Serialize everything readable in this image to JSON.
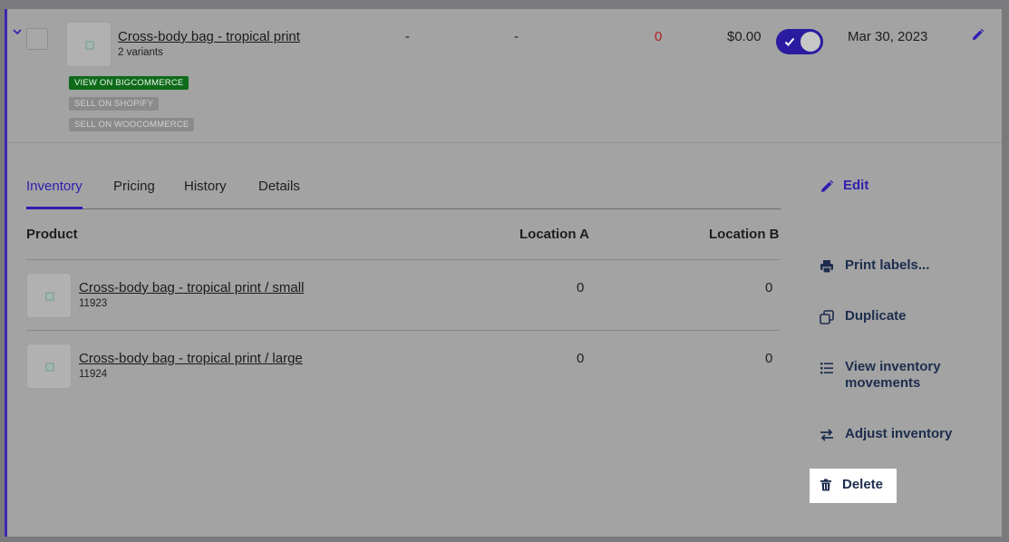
{
  "product": {
    "title": "Cross-body bag - tropical print",
    "variants_text": "2 variants",
    "badges": [
      "VIEW ON BIGCOMMERCE",
      "SELL ON SHOPIFY",
      "SELL ON WOOCOMMERCE"
    ],
    "col1": "-",
    "col2": "-",
    "stock": "0",
    "price": "$0.00",
    "active": true,
    "date": "Mar 30, 2023"
  },
  "colors": {
    "accent": "#2f1eb0",
    "stock_zero": "#b22222",
    "badge_green": "#0f6b1a"
  },
  "tabs": [
    "Inventory",
    "Pricing",
    "History",
    "Details"
  ],
  "active_tab": "Inventory",
  "table": {
    "headers": [
      "Product",
      "Location A",
      "Location B"
    ],
    "rows": [
      {
        "name": "Cross-body bag - tropical print / small",
        "sku": "11923",
        "loc_a": "0",
        "loc_b": "0"
      },
      {
        "name": "Cross-body bag - tropical print / large",
        "sku": "11924",
        "loc_a": "0",
        "loc_b": "0"
      }
    ]
  },
  "actions": {
    "edit": "Edit",
    "print_labels": "Print labels...",
    "duplicate": "Duplicate",
    "view_movements_line1": "View inventory",
    "view_movements_line2": "movements",
    "adjust": "Adjust inventory",
    "delete": "Delete"
  }
}
